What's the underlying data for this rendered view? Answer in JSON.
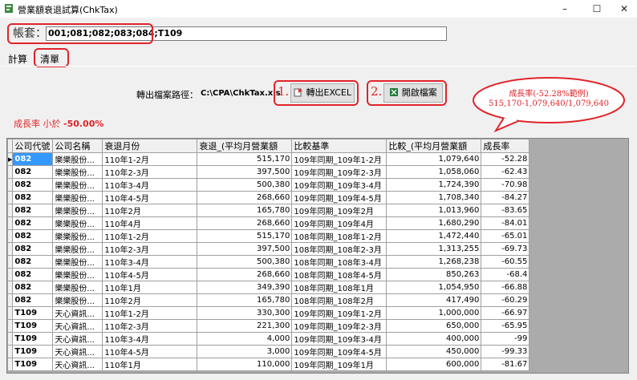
{
  "window": {
    "title": "營業額衰退試算(ChkTax)",
    "minimize": "–",
    "maximize": "☐",
    "close": "✕"
  },
  "account": {
    "label": "帳套：",
    "value": "001;081;082;083;084;T109"
  },
  "tabs": [
    {
      "label": "計算"
    },
    {
      "label": "清單"
    }
  ],
  "export": {
    "path_label": "轉出檔案路徑：",
    "path_value": "C:\\CPA\\ChkTax.xls",
    "excel_button": "轉出EXCEL",
    "open_button": "開啟檔案",
    "num1": "1.",
    "num2": "2."
  },
  "growth": {
    "label": "成長率 小於 ",
    "value": "-50.00%"
  },
  "callout": {
    "line1": "成長率(-52.28%範例)",
    "line2": "515,170-1,079,640/1,079,640"
  },
  "grid": {
    "columns": [
      "公司代號",
      "公司名稱",
      "衰退月份",
      "衰退_(平均月營業額",
      "比較基準",
      "比較_(平均月營業額",
      "成長率"
    ],
    "rows": [
      [
        "082",
        "樂樂股份...",
        "110年1-2月",
        "515,170",
        "109年同期_109年1-2月",
        "1,079,640",
        "-52.28"
      ],
      [
        "082",
        "樂樂股份...",
        "110年2-3月",
        "397,500",
        "109年同期_109年2-3月",
        "1,058,060",
        "-62.43"
      ],
      [
        "082",
        "樂樂股份...",
        "110年3-4月",
        "500,380",
        "109年同期_109年3-4月",
        "1,724,390",
        "-70.98"
      ],
      [
        "082",
        "樂樂股份...",
        "110年4-5月",
        "268,660",
        "109年同期_109年4-5月",
        "1,708,340",
        "-84.27"
      ],
      [
        "082",
        "樂樂股份...",
        "110年2月",
        "165,780",
        "109年同期_109年2月",
        "1,013,960",
        "-83.65"
      ],
      [
        "082",
        "樂樂股份...",
        "110年4月",
        "268,660",
        "109年同期_109年4月",
        "1,680,290",
        "-84.01"
      ],
      [
        "082",
        "樂樂股份...",
        "110年1-2月",
        "515,170",
        "108年同期_108年1-2月",
        "1,472,440",
        "-65.01"
      ],
      [
        "082",
        "樂樂股份...",
        "110年2-3月",
        "397,500",
        "108年同期_108年2-3月",
        "1,313,255",
        "-69.73"
      ],
      [
        "082",
        "樂樂股份...",
        "110年3-4月",
        "500,380",
        "108年同期_108年3-4月",
        "1,268,238",
        "-60.55"
      ],
      [
        "082",
        "樂樂股份...",
        "110年4-5月",
        "268,660",
        "108年同期_108年4-5月",
        "850,263",
        "-68.4"
      ],
      [
        "082",
        "樂樂股份...",
        "110年1月",
        "349,390",
        "108年同期_108年1月",
        "1,054,950",
        "-66.88"
      ],
      [
        "082",
        "樂樂股份...",
        "110年2月",
        "165,780",
        "108年同期_108年2月",
        "417,490",
        "-60.29"
      ],
      [
        "T109",
        "天心資訊...",
        "110年1-2月",
        "330,300",
        "109年同期_109年1-2月",
        "1,000,000",
        "-66.97"
      ],
      [
        "T109",
        "天心資訊...",
        "110年2-3月",
        "221,300",
        "109年同期_109年2-3月",
        "650,000",
        "-65.95"
      ],
      [
        "T109",
        "天心資訊...",
        "110年3-4月",
        "4,000",
        "109年同期_109年3-4月",
        "400,000",
        "-99"
      ],
      [
        "T109",
        "天心資訊...",
        "110年4-5月",
        "3,000",
        "109年同期_109年4-5月",
        "450,000",
        "-99.33"
      ],
      [
        "T109",
        "天心資訊...",
        "110年1月",
        "110,000",
        "109年同期_109年1月",
        "600,000",
        "-81.67"
      ]
    ]
  },
  "colors": {
    "annotation": "#e0242a",
    "selection": "#3399ff"
  },
  "icons": {
    "app": "app-icon",
    "excel_export": "excel-export-icon",
    "open_file": "excel-file-icon",
    "row_pointer": "row-pointer-icon"
  }
}
